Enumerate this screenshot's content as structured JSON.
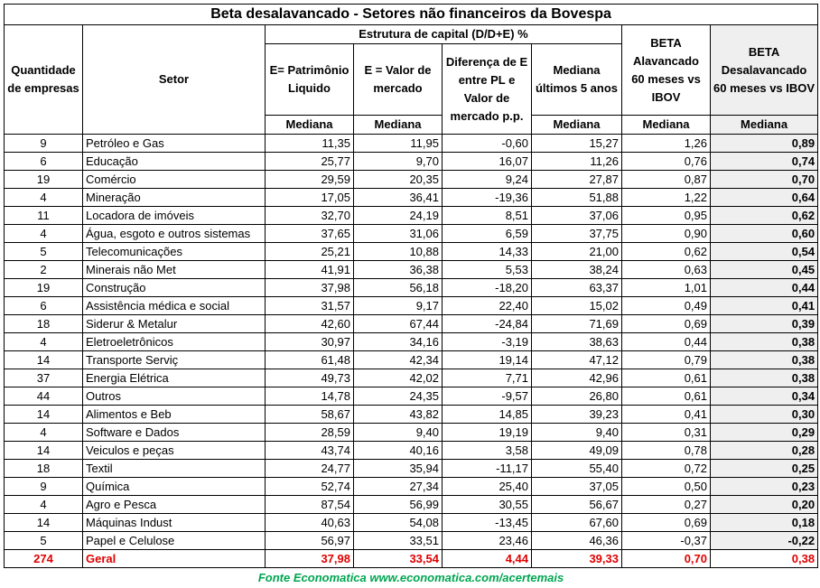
{
  "title": "Beta desalavancado - Setores não financeiros da Bovespa",
  "headers": {
    "qty": "Quantidade de empresas",
    "sector": "Setor",
    "capital_group": "Estrutura de capital (D/D+E) %",
    "e_pl": "E= Patrimônio Liquido",
    "e_market": "E = Valor de mercado",
    "diff": "Diferença de E entre PL e Valor de mercado p.p.",
    "median5": "Mediana últimos 5 anos",
    "beta_lev": "BETA Alavancado 60 meses vs IBOV",
    "beta_unlev": "BETA Desalavancado 60 meses vs IBOV",
    "mediana": "Mediana"
  },
  "rows": [
    {
      "qty": "9",
      "sector": "Petróleo e Gas",
      "e_pl": "11,35",
      "e_mkt": "11,95",
      "diff": "-0,60",
      "med5": "15,27",
      "beta_l": "1,26",
      "beta_u": "0,89"
    },
    {
      "qty": "6",
      "sector": "Educação",
      "e_pl": "25,77",
      "e_mkt": "9,70",
      "diff": "16,07",
      "med5": "11,26",
      "beta_l": "0,76",
      "beta_u": "0,74"
    },
    {
      "qty": "19",
      "sector": "Comércio",
      "e_pl": "29,59",
      "e_mkt": "20,35",
      "diff": "9,24",
      "med5": "27,87",
      "beta_l": "0,87",
      "beta_u": "0,70"
    },
    {
      "qty": "4",
      "sector": "Mineração",
      "e_pl": "17,05",
      "e_mkt": "36,41",
      "diff": "-19,36",
      "med5": "51,88",
      "beta_l": "1,22",
      "beta_u": "0,64"
    },
    {
      "qty": "11",
      "sector": "Locadora de imóveis",
      "e_pl": "32,70",
      "e_mkt": "24,19",
      "diff": "8,51",
      "med5": "37,06",
      "beta_l": "0,95",
      "beta_u": "0,62"
    },
    {
      "qty": "4",
      "sector": "Água, esgoto e outros sistemas",
      "e_pl": "37,65",
      "e_mkt": "31,06",
      "diff": "6,59",
      "med5": "37,75",
      "beta_l": "0,90",
      "beta_u": "0,60"
    },
    {
      "qty": "5",
      "sector": "Telecomunicações",
      "e_pl": "25,21",
      "e_mkt": "10,88",
      "diff": "14,33",
      "med5": "21,00",
      "beta_l": "0,62",
      "beta_u": "0,54"
    },
    {
      "qty": "2",
      "sector": "Minerais não Met",
      "e_pl": "41,91",
      "e_mkt": "36,38",
      "diff": "5,53",
      "med5": "38,24",
      "beta_l": "0,63",
      "beta_u": "0,45"
    },
    {
      "qty": "19",
      "sector": "Construção",
      "e_pl": "37,98",
      "e_mkt": "56,18",
      "diff": "-18,20",
      "med5": "63,37",
      "beta_l": "1,01",
      "beta_u": "0,44"
    },
    {
      "qty": "6",
      "sector": "Assistência médica e social",
      "e_pl": "31,57",
      "e_mkt": "9,17",
      "diff": "22,40",
      "med5": "15,02",
      "beta_l": "0,49",
      "beta_u": "0,41"
    },
    {
      "qty": "18",
      "sector": "Siderur & Metalur",
      "e_pl": "42,60",
      "e_mkt": "67,44",
      "diff": "-24,84",
      "med5": "71,69",
      "beta_l": "0,69",
      "beta_u": "0,39"
    },
    {
      "qty": "4",
      "sector": "Eletroeletrônicos",
      "e_pl": "30,97",
      "e_mkt": "34,16",
      "diff": "-3,19",
      "med5": "38,63",
      "beta_l": "0,44",
      "beta_u": "0,38"
    },
    {
      "qty": "14",
      "sector": "Transporte Serviç",
      "e_pl": "61,48",
      "e_mkt": "42,34",
      "diff": "19,14",
      "med5": "47,12",
      "beta_l": "0,79",
      "beta_u": "0,38"
    },
    {
      "qty": "37",
      "sector": "Energia Elétrica",
      "e_pl": "49,73",
      "e_mkt": "42,02",
      "diff": "7,71",
      "med5": "42,96",
      "beta_l": "0,61",
      "beta_u": "0,38"
    },
    {
      "qty": "44",
      "sector": "Outros",
      "e_pl": "14,78",
      "e_mkt": "24,35",
      "diff": "-9,57",
      "med5": "26,80",
      "beta_l": "0,61",
      "beta_u": "0,34"
    },
    {
      "qty": "14",
      "sector": "Alimentos e Beb",
      "e_pl": "58,67",
      "e_mkt": "43,82",
      "diff": "14,85",
      "med5": "39,23",
      "beta_l": "0,41",
      "beta_u": "0,30"
    },
    {
      "qty": "4",
      "sector": "Software e Dados",
      "e_pl": "28,59",
      "e_mkt": "9,40",
      "diff": "19,19",
      "med5": "9,40",
      "beta_l": "0,31",
      "beta_u": "0,29"
    },
    {
      "qty": "14",
      "sector": "Veiculos e peças",
      "e_pl": "43,74",
      "e_mkt": "40,16",
      "diff": "3,58",
      "med5": "49,09",
      "beta_l": "0,78",
      "beta_u": "0,28"
    },
    {
      "qty": "18",
      "sector": "Textil",
      "e_pl": "24,77",
      "e_mkt": "35,94",
      "diff": "-11,17",
      "med5": "55,40",
      "beta_l": "0,72",
      "beta_u": "0,25"
    },
    {
      "qty": "9",
      "sector": "Química",
      "e_pl": "52,74",
      "e_mkt": "27,34",
      "diff": "25,40",
      "med5": "37,05",
      "beta_l": "0,50",
      "beta_u": "0,23"
    },
    {
      "qty": "4",
      "sector": "Agro e Pesca",
      "e_pl": "87,54",
      "e_mkt": "56,99",
      "diff": "30,55",
      "med5": "56,67",
      "beta_l": "0,27",
      "beta_u": "0,20"
    },
    {
      "qty": "14",
      "sector": "Máquinas Indust",
      "e_pl": "40,63",
      "e_mkt": "54,08",
      "diff": "-13,45",
      "med5": "67,60",
      "beta_l": "0,69",
      "beta_u": "0,18"
    },
    {
      "qty": "5",
      "sector": "Papel e Celulose",
      "e_pl": "56,97",
      "e_mkt": "33,51",
      "diff": "23,46",
      "med5": "46,36",
      "beta_l": "-0,37",
      "beta_u": "-0,22"
    }
  ],
  "total": {
    "qty": "274",
    "sector": "Geral",
    "e_pl": "37,98",
    "e_mkt": "33,54",
    "diff": "4,44",
    "med5": "39,33",
    "beta_l": "0,70",
    "beta_u": "0,38"
  },
  "source": "Fonte Economatica www.economatica.com/acertemais",
  "colors": {
    "total_text": "#e00000",
    "source_text": "#00a651",
    "highlight_bg": "#efefef"
  }
}
